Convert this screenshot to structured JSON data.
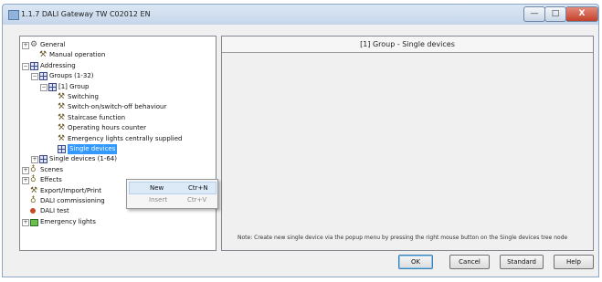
{
  "window": {
    "title": "1.1.7 DALI Gateway TW C02012 EN",
    "minimize_glyph": "—",
    "maximize_glyph": "□",
    "close_glyph": "X"
  },
  "tree": {
    "items": [
      {
        "label": "General",
        "icon": "settings-icon",
        "expander": "+"
      },
      {
        "label": "Manual operation",
        "icon": "manual-icon",
        "expander": ""
      },
      {
        "label": "Addressing",
        "icon": "grid-icon",
        "expander": "−"
      },
      {
        "label": "Groups (1-32)",
        "icon": "grid-icon",
        "expander": "−"
      },
      {
        "label": "[1] Group",
        "icon": "group-icon",
        "expander": "−"
      },
      {
        "label": "Switching",
        "icon": "param-icon",
        "expander": ""
      },
      {
        "label": "Switch-on/switch-off behaviour",
        "icon": "param-icon",
        "expander": ""
      },
      {
        "label": "Staircase function",
        "icon": "param-icon",
        "expander": ""
      },
      {
        "label": "Operating hours counter",
        "icon": "param-icon",
        "expander": ""
      },
      {
        "label": "Emergency lights centrally supplied",
        "icon": "param-icon",
        "expander": ""
      },
      {
        "label": "Single devices",
        "icon": "group-icon",
        "expander": "",
        "selected": true
      },
      {
        "label": "Single devices (1-64)",
        "icon": "grid-icon",
        "expander": "+"
      },
      {
        "label": "Scenes",
        "icon": "bulb-icon",
        "expander": "+"
      },
      {
        "label": "Effects",
        "icon": "bulb-icon",
        "expander": "+"
      },
      {
        "label": "Export/Import/Print",
        "icon": "export-icon",
        "expander": ""
      },
      {
        "label": "DALI commissioning",
        "icon": "bulb-icon",
        "expander": ""
      },
      {
        "label": "DALI test",
        "icon": "test-icon",
        "expander": ""
      },
      {
        "label": "Emergency lights",
        "icon": "monitor-icon",
        "expander": "+"
      }
    ]
  },
  "context_menu": {
    "items": [
      {
        "label": "New",
        "shortcut": "Ctr+N",
        "enabled": true
      },
      {
        "label": "Insert",
        "shortcut": "Ctr+V",
        "enabled": false
      }
    ]
  },
  "panel": {
    "title": "[1] Group - Single devices",
    "note": "Note: Create new single device via the popup menu by pressing the right mouse button on the Single devices tree node"
  },
  "buttons": {
    "ok": "OK",
    "cancel": "Cancel",
    "standard": "Standard",
    "help": "Help"
  },
  "colors": {
    "selection": "#3399ff",
    "close_button": "#c2412b"
  }
}
